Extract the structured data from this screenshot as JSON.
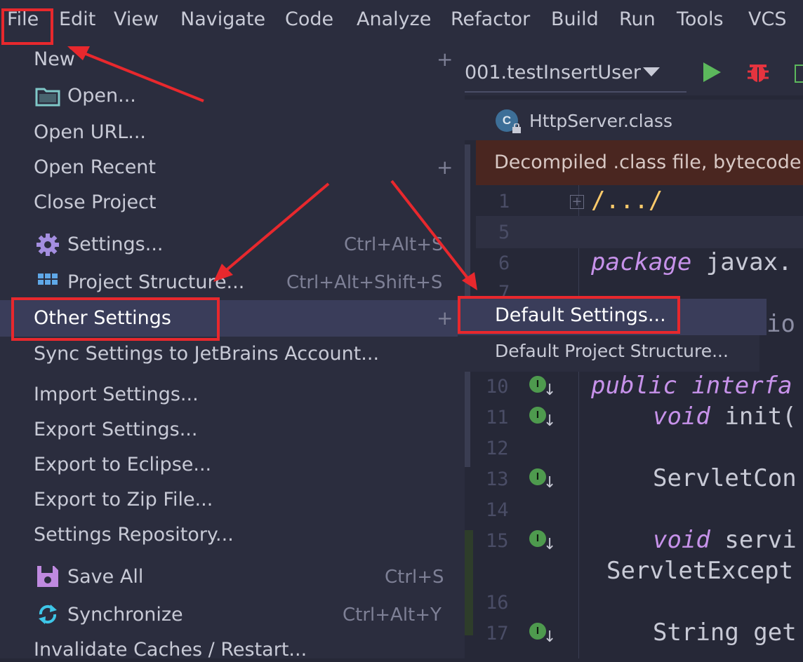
{
  "menubar": {
    "items": [
      "File",
      "Edit",
      "View",
      "Navigate",
      "Code",
      "Analyze",
      "Refactor",
      "Build",
      "Run",
      "Tools",
      "VCS"
    ]
  },
  "file_menu": {
    "items": [
      {
        "label": "New",
        "has_submenu": true
      },
      {
        "label": "Open...",
        "icon": "folder-icon"
      },
      {
        "label": "Open URL..."
      },
      {
        "label": "Open Recent",
        "has_submenu": true
      },
      {
        "label": "Close Project"
      },
      {
        "label": "Settings...",
        "icon": "gear-icon",
        "shortcut": "Ctrl+Alt+S"
      },
      {
        "label": "Project Structure...",
        "icon": "grid-icon",
        "shortcut": "Ctrl+Alt+Shift+S"
      },
      {
        "label": "Other Settings",
        "has_submenu": true,
        "selected": true
      },
      {
        "label": "Sync Settings to JetBrains Account..."
      },
      {
        "label": "Import Settings..."
      },
      {
        "label": "Export Settings..."
      },
      {
        "label": "Export to Eclipse..."
      },
      {
        "label": "Export to Zip File..."
      },
      {
        "label": "Settings Repository..."
      },
      {
        "label": "Save All",
        "icon": "save-icon",
        "shortcut": "Ctrl+S"
      },
      {
        "label": "Synchronize",
        "icon": "sync-icon",
        "shortcut": "Ctrl+Alt+Y"
      },
      {
        "label": "Invalidate Caches / Restart..."
      }
    ],
    "plus_glyph": "+"
  },
  "submenu": {
    "items": [
      "Default Settings...",
      "Default Project Structure..."
    ]
  },
  "toolbar": {
    "run_config": "001.testInsertUser"
  },
  "editor": {
    "tab_title": "HttpServer.class",
    "banner": "Decompiled .class file, bytecode v",
    "line_numbers": [
      "1",
      "5",
      "6",
      "7",
      "10",
      "11",
      "12",
      "13",
      "14",
      "15",
      "16",
      "17"
    ],
    "code": {
      "l1": "/.../",
      "l6_kw": "package",
      "l6_rest": " javax.",
      "l7_tail": "io",
      "l10_kw1": "public",
      "l10_kw2": "interfa",
      "l11_kw": "void",
      "l11_rest": " init(",
      "l13": "ServletCon",
      "l15_kw": "void",
      "l15_rest": " servi",
      "l15b": "ServletExcept",
      "l17": "String get"
    },
    "gutter_glyph": "I"
  },
  "colors": {
    "highlight": "#e8282d",
    "keyword": "#c792ea",
    "run": "#5cb85c",
    "debug": "#e5343f",
    "banner": "#4a2620"
  }
}
